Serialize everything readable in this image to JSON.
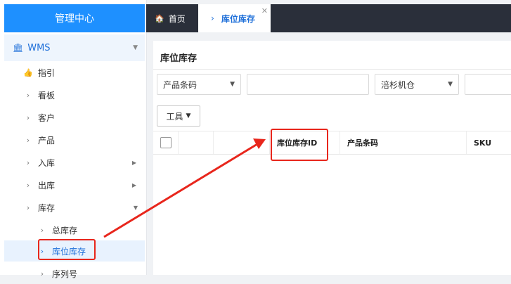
{
  "sidebar": {
    "brand": "管理中心",
    "section": "WMS",
    "items": [
      {
        "label": "指引"
      },
      {
        "label": "看板"
      },
      {
        "label": "客户"
      },
      {
        "label": "产品"
      },
      {
        "label": "入库"
      },
      {
        "label": "出库"
      },
      {
        "label": "库存"
      },
      {
        "label": "总库存"
      },
      {
        "label": "库位库存"
      },
      {
        "label": "序列号"
      }
    ]
  },
  "tabs": {
    "home": "首页",
    "active": "库位库存"
  },
  "page": {
    "title": "库位库存",
    "filters": {
      "field1": "产品条码",
      "field3": "涪杉机仓"
    },
    "tool_button": "工具",
    "columns": [
      "库位库存ID",
      "产品条码",
      "SKU"
    ]
  },
  "colors": {
    "accent": "#1e90ff",
    "topbar": "#2a2f3a",
    "annotation": "#e8261c"
  }
}
